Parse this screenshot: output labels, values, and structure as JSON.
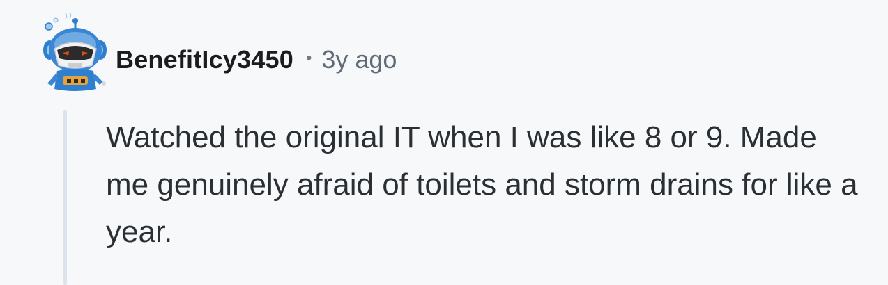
{
  "comment": {
    "username": "BenefitIcy3450",
    "separator": "•",
    "timestamp": "3y ago",
    "body": "Watched the original IT when I was like 8 or 9. Made me genuinely afraid of toilets and storm drains for like a year."
  },
  "colors": {
    "background": "#f7f8fa",
    "username": "#1c1c1c",
    "timestamp": "#5f6b78",
    "body_text": "#2a2f33",
    "thread_line": "#dde3ea",
    "avatar_primary": "#2f7fd0",
    "avatar_secondary": "#9cc8ec",
    "avatar_visor": "#2b2b2b",
    "avatar_eyes": "#e04a1a"
  },
  "icons": {
    "avatar": "robot-snoo-avatar"
  }
}
